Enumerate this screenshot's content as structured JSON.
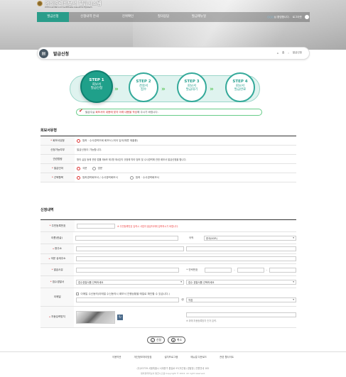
{
  "header": {
    "logo_title": "범죄경력회보서 발급시스템",
    "logo_subtitle": "Criminal Record Certificate Issuance System",
    "nav": [
      "발급신청",
      "신청내역 안내",
      "진위확인",
      "질의응답",
      "발급매뉴얼"
    ],
    "welcome_name": "○○○",
    "welcome_suffix": "님 환영합니다.",
    "logout": "로그아웃"
  },
  "page": {
    "title": "발급신청",
    "breadcrumb_home": "홈",
    "breadcrumb_current": "발급신청"
  },
  "steps": [
    {
      "num": "STEP 1",
      "line1": "회보서",
      "line2": "발급신청"
    },
    {
      "num": "STEP 2",
      "line1": "경찰서",
      "line2": "접수"
    },
    {
      "num": "STEP 3",
      "line1": "회보서",
      "line2": "발급대기"
    },
    {
      "num": "STEP 4",
      "line1": "회보서",
      "line2": "발급완료"
    }
  ],
  "notice": {
    "pre": "발급주실 ",
    "highlight": "회보서의 내용에 맞지 아래 내용을 작성",
    "post": "해 주시기 바랍니다."
  },
  "section1": {
    "title": "회보서유형",
    "rows": {
      "type_label": "회보서유형",
      "type_value": "범죄 · 수사경력조회 회보서 (외국 입국/체류 제출용)",
      "target_label": "신청가능여부",
      "target_value": "발급신청이 가능합니다.",
      "desc_label": "관련법령",
      "desc_value": "형의 실효 등에 관한 법률 제6조 제1항 제4호의 규정에 따라 범죄 및 수사경력에 관한 회보서 발급신청을 합니다.",
      "lang_label": "발급언어",
      "lang_opt1": "국문",
      "lang_opt2": "영문",
      "scope_label": "선택항목",
      "scope_opt1": "범죄경력회보서 / 수사경력회보서",
      "scope_opt2": "범죄 · 수사경력회보서"
    }
  },
  "section2": {
    "title": "신청내역",
    "rows": {
      "rrn_label": "주민등록번호",
      "rrn_warn": "※ 주민등록번호 입력시 사업자 발급처리에 입력하시기 바랍니다.",
      "name_label": "이름(한글)",
      "nation_label": "국적",
      "nation_value": "한국(KOR)",
      "addr_label": "현주소",
      "addr2_label": "국문 상세주소",
      "purpose_label": "발급사유",
      "phone_label": "연락번호",
      "office_label": "접수경찰서",
      "office_value": "접수경찰서를 선택하세요",
      "office_value2": "접수 경찰서를 선택하세요",
      "email_label": "이메일",
      "email_note": "이메일 수신동의(이메일 수신동의시 회보서 진행상황을 메일로 확인할 수 있습니다.)",
      "email_domain": "직접",
      "captcha_label": "자동입력방지",
      "captcha_note": "※ 위에 자동등록방지 숫자 입력."
    }
  },
  "buttons": {
    "apply": "신청",
    "cancel": "취소"
  },
  "footer": {
    "links": [
      "이용약관",
      "개인정보처리방침",
      "설치프로그램",
      "매뉴얼 다운로드",
      "관련 웹사이트"
    ],
    "address": "(우)03739 서울특별시 서대문구 통일로 97(미근동) 경찰청 | 민원안내 182",
    "copyright": "범죄경력회보서 발급시스템 Copyright © 2024. All right reserved."
  },
  "colors": {
    "accent": "#1fa08a",
    "nav_active": "#2a9d8a",
    "required": "#cc2222"
  }
}
